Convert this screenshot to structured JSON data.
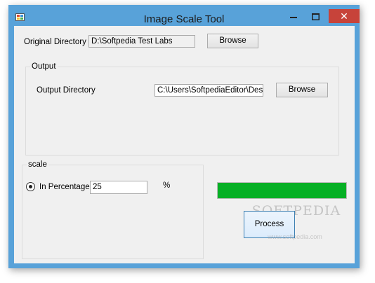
{
  "window": {
    "title": "Image Scale Tool",
    "close_glyph": "✕",
    "icon": "app-icon"
  },
  "original": {
    "label": "Original Directory",
    "value": "D:\\Softpedia Test Labs",
    "browse_label": "Browse"
  },
  "output": {
    "group_label": "Output",
    "label": "Output Directory",
    "value": "C:\\Users\\SoftpediaEditor\\Desk",
    "browse_label": "Browse"
  },
  "scale": {
    "group_label": "scale",
    "radio_label": "In Percentage",
    "value": "25",
    "unit": "%",
    "selected": true
  },
  "progress": {
    "fraction": 1.0
  },
  "process_label": "Process",
  "watermark": {
    "text": "SOFTPEDIA",
    "sub": "www.softpedia.com"
  },
  "colors": {
    "titlebar": "#58a2d9",
    "close": "#c7433a",
    "progress": "#06b025"
  }
}
